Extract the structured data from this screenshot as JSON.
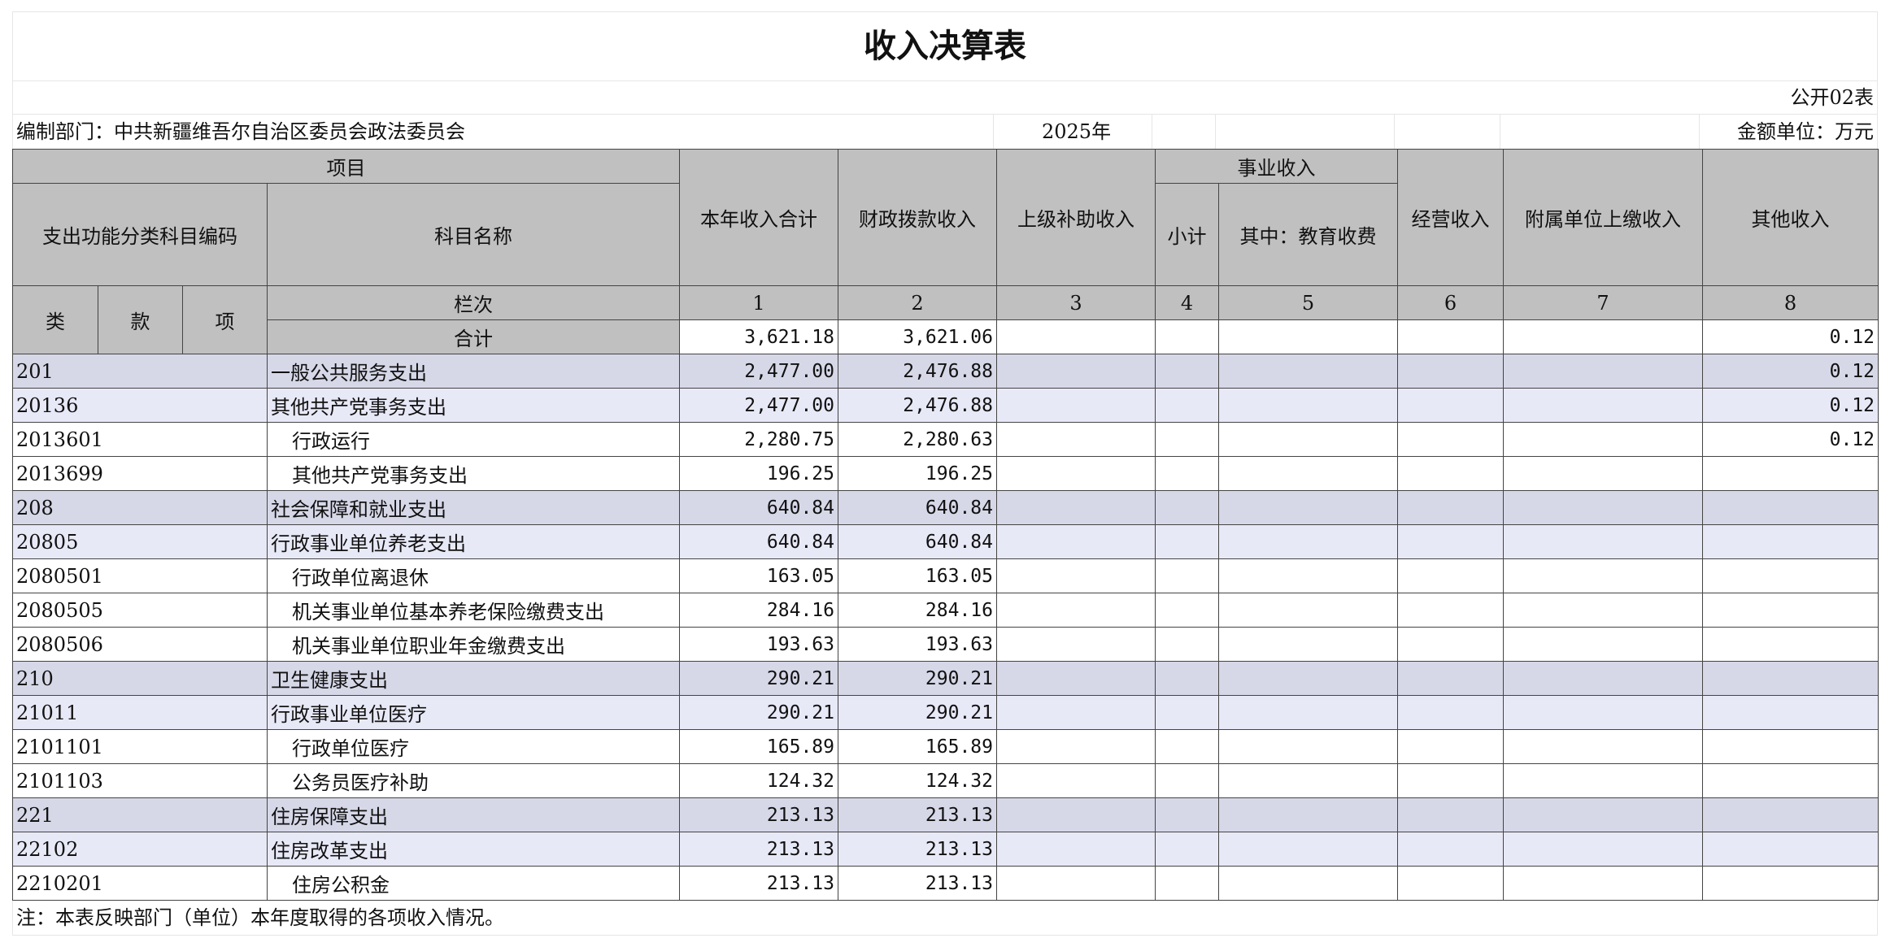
{
  "title": "收入决算表",
  "form_code": "公开02表",
  "department": "编制部门：中共新疆维吾尔自治区委员会政法委员会",
  "year": "2025年",
  "unit": "金额单位：万元",
  "headers": {
    "project": "项目",
    "func_code": "支出功能分类科目编码",
    "subject_name": "科目名称",
    "total_income": "本年收入合计",
    "fiscal": "财政拨款收入",
    "superior": "上级补助收入",
    "business": "事业收入",
    "subtotal": "小计",
    "edu_fee": "其中：教育收费",
    "operating": "经营收入",
    "affiliated": "附属单位上缴收入",
    "other": "其他收入",
    "lei": "类",
    "kuan": "款",
    "xiang": "项",
    "column_no": "栏次",
    "col_numbers": [
      "1",
      "2",
      "3",
      "4",
      "5",
      "6",
      "7",
      "8"
    ],
    "total": "合计"
  },
  "totals": {
    "c1": "3,621.18",
    "c2": "3,621.06",
    "c8": "0.12"
  },
  "rows": [
    {
      "level": 1,
      "code": "201",
      "name": "一般公共服务支出",
      "c1": "2,477.00",
      "c2": "2,476.88",
      "c8": "0.12"
    },
    {
      "level": 2,
      "code": "20136",
      "name": "其他共产党事务支出",
      "c1": "2,477.00",
      "c2": "2,476.88",
      "c8": "0.12"
    },
    {
      "level": 3,
      "code": "2013601",
      "name": "行政运行",
      "c1": "2,280.75",
      "c2": "2,280.63",
      "c8": "0.12"
    },
    {
      "level": 3,
      "code": "2013699",
      "name": "其他共产党事务支出",
      "c1": "196.25",
      "c2": "196.25",
      "c8": ""
    },
    {
      "level": 1,
      "code": "208",
      "name": "社会保障和就业支出",
      "c1": "640.84",
      "c2": "640.84",
      "c8": ""
    },
    {
      "level": 2,
      "code": "20805",
      "name": "行政事业单位养老支出",
      "c1": "640.84",
      "c2": "640.84",
      "c8": ""
    },
    {
      "level": 3,
      "code": "2080501",
      "name": "行政单位离退休",
      "c1": "163.05",
      "c2": "163.05",
      "c8": ""
    },
    {
      "level": 3,
      "code": "2080505",
      "name": "机关事业单位基本养老保险缴费支出",
      "c1": "284.16",
      "c2": "284.16",
      "c8": ""
    },
    {
      "level": 3,
      "code": "2080506",
      "name": "机关事业单位职业年金缴费支出",
      "c1": "193.63",
      "c2": "193.63",
      "c8": ""
    },
    {
      "level": 1,
      "code": "210",
      "name": "卫生健康支出",
      "c1": "290.21",
      "c2": "290.21",
      "c8": ""
    },
    {
      "level": 2,
      "code": "21011",
      "name": "行政事业单位医疗",
      "c1": "290.21",
      "c2": "290.21",
      "c8": ""
    },
    {
      "level": 3,
      "code": "2101101",
      "name": "行政单位医疗",
      "c1": "165.89",
      "c2": "165.89",
      "c8": ""
    },
    {
      "level": 3,
      "code": "2101103",
      "name": "公务员医疗补助",
      "c1": "124.32",
      "c2": "124.32",
      "c8": ""
    },
    {
      "level": 1,
      "code": "221",
      "name": "住房保障支出",
      "c1": "213.13",
      "c2": "213.13",
      "c8": ""
    },
    {
      "level": 2,
      "code": "22102",
      "name": "住房改革支出",
      "c1": "213.13",
      "c2": "213.13",
      "c8": ""
    },
    {
      "level": 3,
      "code": "2210201",
      "name": "住房公积金",
      "c1": "213.13",
      "c2": "213.13",
      "c8": ""
    }
  ],
  "note": "注：本表反映部门（单位）本年度取得的各项收入情况。"
}
